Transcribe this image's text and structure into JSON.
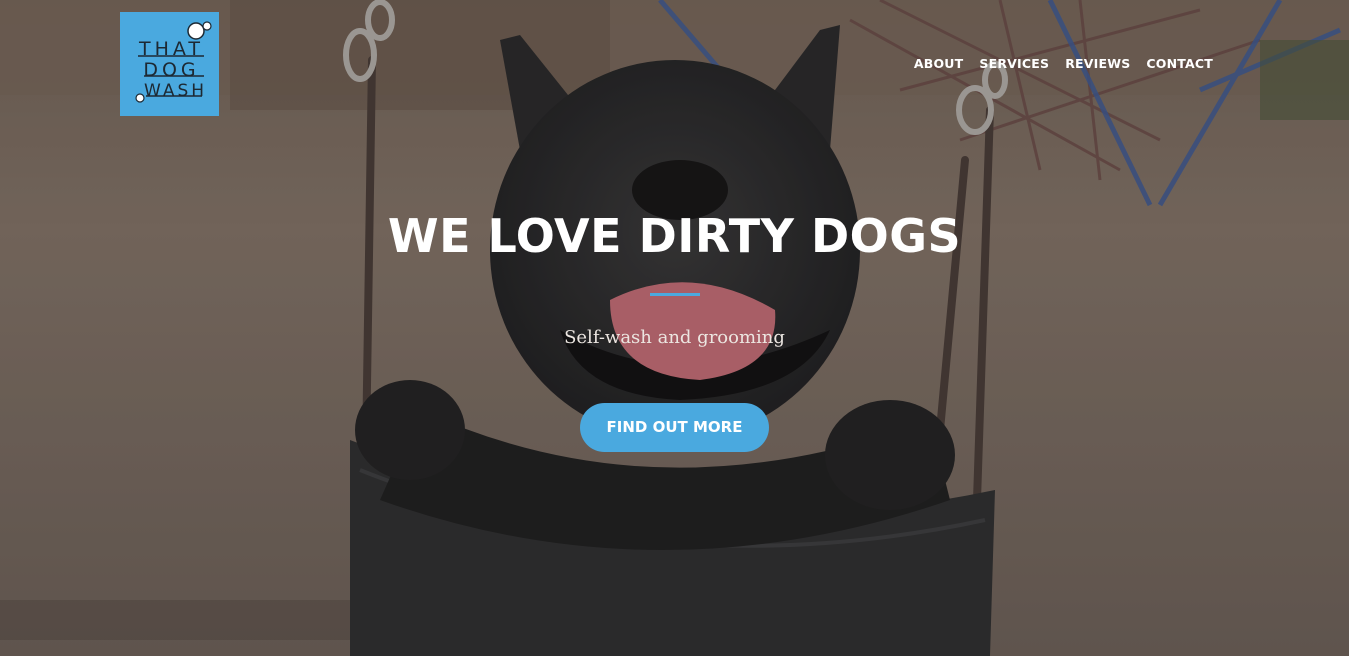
{
  "brand": {
    "logo_words": [
      "THAT",
      "DOG",
      "WASH"
    ],
    "logo_bg": "#4aa9df"
  },
  "nav": {
    "items": [
      {
        "label": "ABOUT"
      },
      {
        "label": "SERVICES"
      },
      {
        "label": "REVIEWS"
      },
      {
        "label": "CONTACT"
      }
    ]
  },
  "hero": {
    "title": "WE LOVE DIRTY DOGS",
    "subtitle": "Self-wash and grooming",
    "cta_label": "FIND OUT MORE",
    "accent": "#4aa9df",
    "background_image": "french-bulldog-in-swing"
  }
}
